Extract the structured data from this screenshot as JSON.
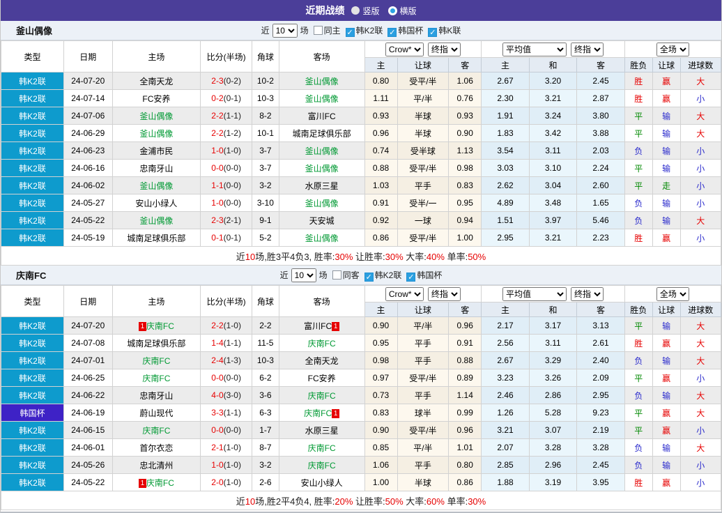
{
  "topbar": {
    "title": "近期战绩",
    "radios": [
      {
        "label": "竖版",
        "selected": true
      },
      {
        "label": "横版",
        "selected": false
      }
    ]
  },
  "columns": {
    "type": "类型",
    "date": "日期",
    "home": "主场",
    "score": "比分(半场)",
    "corner": "角球",
    "away": "客场",
    "odds_home": "主",
    "odds_handicap": "让球",
    "odds_away": "客",
    "avg_home": "主",
    "avg_draw": "和",
    "avg_away": "客",
    "res_wdl": "胜负",
    "res_handicap": "让球",
    "res_goals": "进球数"
  },
  "dropdowns": {
    "odds_source": "Crow*",
    "final_a": "终指",
    "average": "平均值",
    "final_b": "终指",
    "scope": "全场"
  },
  "colors": {
    "topbar_purple": "#4b3e99",
    "league_k2_cyan": "#0e9bcd",
    "league_cup_purple": "#3e22c6",
    "team_green": "#009933",
    "red": "#e60000",
    "blue": "#2929cc",
    "green": "#008800",
    "crow_col_bg": "#fdf8ee",
    "avg_col_bg": "#eaf6fc"
  },
  "sections": [
    {
      "team": "釜山偶像",
      "filters": {
        "near": "近",
        "count": "10",
        "games": "场",
        "same": "同主",
        "leagues": [
          {
            "label": "韩K2联",
            "checked": true
          },
          {
            "label": "韩国杯",
            "checked": true
          },
          {
            "label": "韩K联",
            "checked": true
          }
        ]
      },
      "rows": [
        {
          "league": "韩K2联",
          "ltype": "k2",
          "date": "24-07-20",
          "home": {
            "name": "全南天龙",
            "green": false,
            "badge": null
          },
          "score": "2-3",
          "half": "(0-2)",
          "corner": "10-2",
          "away": {
            "name": "釜山偶像",
            "green": true,
            "badge": null
          },
          "crow": [
            "0.80",
            "受平/半",
            "1.06"
          ],
          "avg": [
            "2.67",
            "3.20",
            "2.45"
          ],
          "res": [
            [
              "胜",
              "r"
            ],
            [
              "赢",
              "r"
            ],
            [
              "大",
              "r"
            ]
          ]
        },
        {
          "league": "韩K2联",
          "ltype": "k2",
          "date": "24-07-14",
          "home": {
            "name": "FC安养",
            "green": false,
            "badge": null
          },
          "score": "0-2",
          "half": "(0-1)",
          "corner": "10-3",
          "away": {
            "name": "釜山偶像",
            "green": true,
            "badge": null
          },
          "crow": [
            "1.11",
            "平/半",
            "0.76"
          ],
          "avg": [
            "2.30",
            "3.21",
            "2.87"
          ],
          "res": [
            [
              "胜",
              "r"
            ],
            [
              "赢",
              "r"
            ],
            [
              "小",
              "b"
            ]
          ]
        },
        {
          "league": "韩K2联",
          "ltype": "k2",
          "date": "24-07-06",
          "home": {
            "name": "釜山偶像",
            "green": true,
            "badge": null
          },
          "score": "2-2",
          "half": "(1-1)",
          "corner": "8-2",
          "away": {
            "name": "富川FC",
            "green": false,
            "badge": null
          },
          "crow": [
            "0.93",
            "半球",
            "0.93"
          ],
          "avg": [
            "1.91",
            "3.24",
            "3.80"
          ],
          "res": [
            [
              "平",
              "g"
            ],
            [
              "输",
              "b"
            ],
            [
              "大",
              "r"
            ]
          ]
        },
        {
          "league": "韩K2联",
          "ltype": "k2",
          "date": "24-06-29",
          "home": {
            "name": "釜山偶像",
            "green": true,
            "badge": null
          },
          "score": "2-2",
          "half": "(1-2)",
          "corner": "10-1",
          "away": {
            "name": "城南足球俱乐部",
            "green": false,
            "badge": null
          },
          "crow": [
            "0.96",
            "半球",
            "0.90"
          ],
          "avg": [
            "1.83",
            "3.42",
            "3.88"
          ],
          "res": [
            [
              "平",
              "g"
            ],
            [
              "输",
              "b"
            ],
            [
              "大",
              "r"
            ]
          ]
        },
        {
          "league": "韩K2联",
          "ltype": "k2",
          "date": "24-06-23",
          "home": {
            "name": "金浦市民",
            "green": false,
            "badge": null
          },
          "score": "1-0",
          "half": "(1-0)",
          "corner": "3-7",
          "away": {
            "name": "釜山偶像",
            "green": true,
            "badge": null
          },
          "crow": [
            "0.74",
            "受半球",
            "1.13"
          ],
          "avg": [
            "3.54",
            "3.11",
            "2.03"
          ],
          "res": [
            [
              "负",
              "b"
            ],
            [
              "输",
              "b"
            ],
            [
              "小",
              "b"
            ]
          ]
        },
        {
          "league": "韩K2联",
          "ltype": "k2",
          "date": "24-06-16",
          "home": {
            "name": "忠南牙山",
            "green": false,
            "badge": null
          },
          "score": "0-0",
          "half": "(0-0)",
          "corner": "3-7",
          "away": {
            "name": "釜山偶像",
            "green": true,
            "badge": null
          },
          "crow": [
            "0.88",
            "受平/半",
            "0.98"
          ],
          "avg": [
            "3.03",
            "3.10",
            "2.24"
          ],
          "res": [
            [
              "平",
              "g"
            ],
            [
              "输",
              "b"
            ],
            [
              "小",
              "b"
            ]
          ]
        },
        {
          "league": "韩K2联",
          "ltype": "k2",
          "date": "24-06-02",
          "home": {
            "name": "釜山偶像",
            "green": true,
            "badge": null
          },
          "score": "1-1",
          "half": "(0-0)",
          "corner": "3-2",
          "away": {
            "name": "水原三星",
            "green": false,
            "badge": null
          },
          "crow": [
            "1.03",
            "平手",
            "0.83"
          ],
          "avg": [
            "2.62",
            "3.04",
            "2.60"
          ],
          "res": [
            [
              "平",
              "g"
            ],
            [
              "走",
              "g"
            ],
            [
              "小",
              "b"
            ]
          ]
        },
        {
          "league": "韩K2联",
          "ltype": "k2",
          "date": "24-05-27",
          "home": {
            "name": "安山小绿人",
            "green": false,
            "badge": null
          },
          "score": "1-0",
          "half": "(0-0)",
          "corner": "3-10",
          "away": {
            "name": "釜山偶像",
            "green": true,
            "badge": null
          },
          "crow": [
            "0.91",
            "受半/一",
            "0.95"
          ],
          "avg": [
            "4.89",
            "3.48",
            "1.65"
          ],
          "res": [
            [
              "负",
              "b"
            ],
            [
              "输",
              "b"
            ],
            [
              "小",
              "b"
            ]
          ]
        },
        {
          "league": "韩K2联",
          "ltype": "k2",
          "date": "24-05-22",
          "home": {
            "name": "釜山偶像",
            "green": true,
            "badge": null
          },
          "score": "2-3",
          "half": "(2-1)",
          "corner": "9-1",
          "away": {
            "name": "天安城",
            "green": false,
            "badge": null
          },
          "crow": [
            "0.92",
            "一球",
            "0.94"
          ],
          "avg": [
            "1.51",
            "3.97",
            "5.46"
          ],
          "res": [
            [
              "负",
              "b"
            ],
            [
              "输",
              "b"
            ],
            [
              "大",
              "r"
            ]
          ]
        },
        {
          "league": "韩K2联",
          "ltype": "k2",
          "date": "24-05-19",
          "home": {
            "name": "城南足球俱乐部",
            "green": false,
            "badge": null
          },
          "score": "0-1",
          "half": "(0-1)",
          "corner": "5-2",
          "away": {
            "name": "釜山偶像",
            "green": true,
            "badge": null
          },
          "crow": [
            "0.86",
            "受平/半",
            "1.00"
          ],
          "avg": [
            "2.95",
            "3.21",
            "2.23"
          ],
          "res": [
            [
              "胜",
              "r"
            ],
            [
              "赢",
              "r"
            ],
            [
              "小",
              "b"
            ]
          ]
        }
      ],
      "summary": [
        {
          "t": "近"
        },
        {
          "t": "10",
          "r": true
        },
        {
          "t": "场,胜3平4负3, 胜率:"
        },
        {
          "t": "30%",
          "r": true
        },
        {
          "t": " 让胜率:"
        },
        {
          "t": "30%",
          "r": true
        },
        {
          "t": " 大率:"
        },
        {
          "t": "40%",
          "r": true
        },
        {
          "t": " 单率:"
        },
        {
          "t": "50%",
          "r": true
        }
      ]
    },
    {
      "team": "庆南FC",
      "filters": {
        "near": "近",
        "count": "10",
        "games": "场",
        "same": "同客",
        "leagues": [
          {
            "label": "韩K2联",
            "checked": true
          },
          {
            "label": "韩国杯",
            "checked": true
          }
        ]
      },
      "rows": [
        {
          "league": "韩K2联",
          "ltype": "k2",
          "date": "24-07-20",
          "home": {
            "name": "庆南FC",
            "green": true,
            "badge": "1"
          },
          "score": "2-2",
          "half": "(1-0)",
          "corner": "2-2",
          "away": {
            "name": "富川FC",
            "green": false,
            "badge": "1"
          },
          "crow": [
            "0.90",
            "平/半",
            "0.96"
          ],
          "avg": [
            "2.17",
            "3.17",
            "3.13"
          ],
          "res": [
            [
              "平",
              "g"
            ],
            [
              "输",
              "b"
            ],
            [
              "大",
              "r"
            ]
          ]
        },
        {
          "league": "韩K2联",
          "ltype": "k2",
          "date": "24-07-08",
          "home": {
            "name": "城南足球俱乐部",
            "green": false,
            "badge": null
          },
          "score": "1-4",
          "half": "(1-1)",
          "corner": "11-5",
          "away": {
            "name": "庆南FC",
            "green": true,
            "badge": null
          },
          "crow": [
            "0.95",
            "平手",
            "0.91"
          ],
          "avg": [
            "2.56",
            "3.11",
            "2.61"
          ],
          "res": [
            [
              "胜",
              "r"
            ],
            [
              "赢",
              "r"
            ],
            [
              "大",
              "r"
            ]
          ]
        },
        {
          "league": "韩K2联",
          "ltype": "k2",
          "date": "24-07-01",
          "home": {
            "name": "庆南FC",
            "green": true,
            "badge": null
          },
          "score": "2-4",
          "half": "(1-3)",
          "corner": "10-3",
          "away": {
            "name": "全南天龙",
            "green": false,
            "badge": null
          },
          "crow": [
            "0.98",
            "平手",
            "0.88"
          ],
          "avg": [
            "2.67",
            "3.29",
            "2.40"
          ],
          "res": [
            [
              "负",
              "b"
            ],
            [
              "输",
              "b"
            ],
            [
              "大",
              "r"
            ]
          ]
        },
        {
          "league": "韩K2联",
          "ltype": "k2",
          "date": "24-06-25",
          "home": {
            "name": "庆南FC",
            "green": true,
            "badge": null
          },
          "score": "0-0",
          "half": "(0-0)",
          "corner": "6-2",
          "away": {
            "name": "FC安养",
            "green": false,
            "badge": null
          },
          "crow": [
            "0.97",
            "受平/半",
            "0.89"
          ],
          "avg": [
            "3.23",
            "3.26",
            "2.09"
          ],
          "res": [
            [
              "平",
              "g"
            ],
            [
              "赢",
              "r"
            ],
            [
              "小",
              "b"
            ]
          ]
        },
        {
          "league": "韩K2联",
          "ltype": "k2",
          "date": "24-06-22",
          "home": {
            "name": "忠南牙山",
            "green": false,
            "badge": null
          },
          "score": "4-0",
          "half": "(3-0)",
          "corner": "3-6",
          "away": {
            "name": "庆南FC",
            "green": true,
            "badge": null
          },
          "crow": [
            "0.73",
            "平手",
            "1.14"
          ],
          "avg": [
            "2.46",
            "2.86",
            "2.95"
          ],
          "res": [
            [
              "负",
              "b"
            ],
            [
              "输",
              "b"
            ],
            [
              "大",
              "r"
            ]
          ]
        },
        {
          "league": "韩国杯",
          "ltype": "cup",
          "date": "24-06-19",
          "home": {
            "name": "蔚山现代",
            "green": false,
            "badge": null
          },
          "score": "3-3",
          "half": "(1-1)",
          "corner": "6-3",
          "away": {
            "name": "庆南FC",
            "green": true,
            "badge": "1"
          },
          "crow": [
            "0.83",
            "球半",
            "0.99"
          ],
          "avg": [
            "1.26",
            "5.28",
            "9.23"
          ],
          "res": [
            [
              "平",
              "g"
            ],
            [
              "赢",
              "r"
            ],
            [
              "大",
              "r"
            ]
          ]
        },
        {
          "league": "韩K2联",
          "ltype": "k2",
          "date": "24-06-15",
          "home": {
            "name": "庆南FC",
            "green": true,
            "badge": null
          },
          "score": "0-0",
          "half": "(0-0)",
          "corner": "1-7",
          "away": {
            "name": "水原三星",
            "green": false,
            "badge": null
          },
          "crow": [
            "0.90",
            "受平/半",
            "0.96"
          ],
          "avg": [
            "3.21",
            "3.07",
            "2.19"
          ],
          "res": [
            [
              "平",
              "g"
            ],
            [
              "赢",
              "r"
            ],
            [
              "小",
              "b"
            ]
          ]
        },
        {
          "league": "韩K2联",
          "ltype": "k2",
          "date": "24-06-01",
          "home": {
            "name": "首尔衣恋",
            "green": false,
            "badge": null
          },
          "score": "2-1",
          "half": "(1-0)",
          "corner": "8-7",
          "away": {
            "name": "庆南FC",
            "green": true,
            "badge": null
          },
          "crow": [
            "0.85",
            "平/半",
            "1.01"
          ],
          "avg": [
            "2.07",
            "3.28",
            "3.28"
          ],
          "res": [
            [
              "负",
              "b"
            ],
            [
              "输",
              "b"
            ],
            [
              "大",
              "r"
            ]
          ]
        },
        {
          "league": "韩K2联",
          "ltype": "k2",
          "date": "24-05-26",
          "home": {
            "name": "忠北清州",
            "green": false,
            "badge": null
          },
          "score": "1-0",
          "half": "(1-0)",
          "corner": "3-2",
          "away": {
            "name": "庆南FC",
            "green": true,
            "badge": null
          },
          "crow": [
            "1.06",
            "平手",
            "0.80"
          ],
          "avg": [
            "2.85",
            "2.96",
            "2.45"
          ],
          "res": [
            [
              "负",
              "b"
            ],
            [
              "输",
              "b"
            ],
            [
              "小",
              "b"
            ]
          ]
        },
        {
          "league": "韩K2联",
          "ltype": "k2",
          "date": "24-05-22",
          "home": {
            "name": "庆南FC",
            "green": true,
            "badge": "1"
          },
          "score": "2-0",
          "half": "(1-0)",
          "corner": "2-6",
          "away": {
            "name": "安山小绿人",
            "green": false,
            "badge": null
          },
          "crow": [
            "1.00",
            "半球",
            "0.86"
          ],
          "avg": [
            "1.88",
            "3.19",
            "3.95"
          ],
          "res": [
            [
              "胜",
              "r"
            ],
            [
              "赢",
              "r"
            ],
            [
              "小",
              "b"
            ]
          ]
        }
      ],
      "summary": [
        {
          "t": "近"
        },
        {
          "t": "10",
          "r": true
        },
        {
          "t": "场,胜2平4负4, 胜率:"
        },
        {
          "t": "20%",
          "r": true
        },
        {
          "t": " 让胜率:"
        },
        {
          "t": "50%",
          "r": true
        },
        {
          "t": " 大率:"
        },
        {
          "t": "60%",
          "r": true
        },
        {
          "t": " 单率:"
        },
        {
          "t": "30%",
          "r": true
        }
      ]
    }
  ]
}
